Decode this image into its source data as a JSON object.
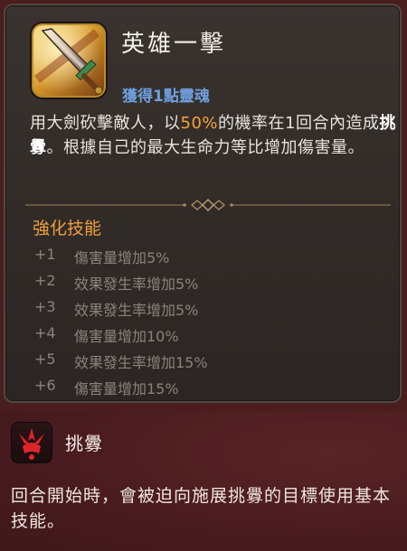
{
  "skill": {
    "title": "英雄一擊",
    "soul_reward": "獲得1點靈魂",
    "description": {
      "part1": "用大劍砍擊敵人，以",
      "chance": "50%",
      "part2": "的機率在1回合內造成",
      "status": "挑釁",
      "part3": "。根據自己的最大生命力等比增加傷害量。"
    },
    "icon": "great-sword-icon"
  },
  "enhancement": {
    "title": "強化技能",
    "items": [
      {
        "level": "+1",
        "effect": "傷害量增加5%"
      },
      {
        "level": "+2",
        "effect": "效果發生率增加5%"
      },
      {
        "level": "+3",
        "effect": "效果發生率增加5%"
      },
      {
        "level": "+4",
        "effect": "傷害量增加10%"
      },
      {
        "level": "+5",
        "effect": "效果發生率增加15%"
      },
      {
        "level": "+6",
        "effect": "傷害量增加15%"
      }
    ]
  },
  "effect": {
    "name": "挑釁",
    "description": "回合開始時，會被迫向施展挑釁的目標使用基本技能。",
    "icon": "provoke-icon"
  },
  "colors": {
    "highlight": "#f3a43a",
    "soul_blue": "#6f9fde",
    "enhance_orange": "#f09d3a",
    "effect_bg": "#4b1d20"
  }
}
